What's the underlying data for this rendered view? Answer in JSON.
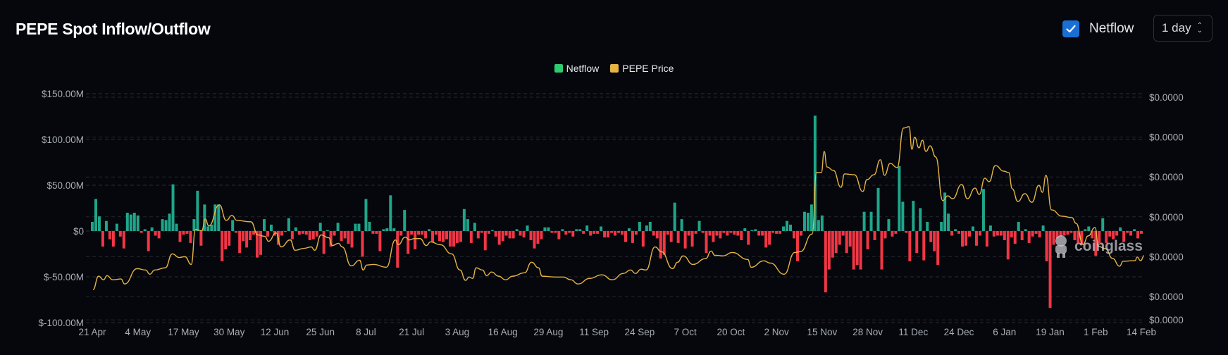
{
  "header": {
    "title": "PEPE Spot Inflow/Outflow",
    "netflow_toggle": {
      "label": "Netflow",
      "checked": true
    },
    "interval_select": {
      "value": "1 day"
    }
  },
  "watermark": "coinglass",
  "colors": {
    "inflow": "#1fa68a",
    "outflow": "#f23645",
    "price": "#e5b443",
    "checkbox": "#1a6fd4"
  },
  "chart_data": {
    "type": "bar+line",
    "title": "PEPE Spot Inflow/Outflow",
    "legend": [
      {
        "label": "Netflow",
        "color": "#2ecc71"
      },
      {
        "label": "PEPE Price",
        "color": "#e5b443"
      }
    ],
    "legend_position": "top-center",
    "grid": true,
    "x_tick_labels": [
      "21 Apr",
      "4 May",
      "17 May",
      "30 May",
      "12 Jun",
      "25 Jun",
      "8 Jul",
      "21 Jul",
      "3 Aug",
      "16 Aug",
      "29 Aug",
      "11 Sep",
      "24 Sep",
      "7 Oct",
      "20 Oct",
      "2 Nov",
      "15 Nov",
      "28 Nov",
      "11 Dec",
      "24 Dec",
      "6 Jan",
      "19 Jan",
      "1 Feb",
      "14 Feb"
    ],
    "x_tick_step_days": 13,
    "days": 300,
    "left_axis": {
      "unit": "USD millions",
      "ylim": [
        -100,
        150
      ],
      "ticks": [
        150,
        100,
        50,
        0,
        -50,
        -100
      ],
      "tick_labels": [
        "$150.00M",
        "$100.00M",
        "$50.00M",
        "$0",
        "$-50.00M",
        "$-100.00M"
      ]
    },
    "right_axis": {
      "unit": "USD (x1e-6, approx)",
      "ylim": [
        4.83,
        16.2
      ],
      "ticks": [
        16,
        14,
        12,
        10,
        8,
        6,
        4.83
      ],
      "tick_labels": [
        "$0.0000",
        "$0.0000",
        "$0.0000",
        "$0.0000",
        "$0.0000",
        "$0.0000",
        "$0.0000"
      ]
    },
    "netflow_musd": [
      10,
      35,
      16,
      -17,
      11,
      -9,
      -17,
      8,
      -6,
      -19,
      20,
      18,
      20,
      17,
      -2,
      2,
      -22,
      4,
      -5,
      -8,
      13,
      12,
      19,
      51,
      8,
      -12,
      -4,
      -3,
      -13,
      13,
      44,
      -16,
      29,
      5,
      7,
      29,
      29,
      -33,
      -20,
      -16,
      12,
      -2,
      -24,
      -11,
      -18,
      -10,
      -4,
      -29,
      -26,
      13,
      -6,
      7,
      -5,
      -15,
      -5,
      -1,
      14,
      -9,
      4,
      -4,
      -3,
      -4,
      -10,
      -9,
      -6,
      9,
      -25,
      1,
      -17,
      -5,
      9,
      -11,
      -8,
      -14,
      -18,
      8,
      8,
      -28,
      35,
      10,
      -3,
      -3,
      -22,
      2,
      3,
      39,
      3,
      -40,
      -5,
      23,
      -25,
      -4,
      -20,
      -4,
      -4,
      -8,
      2,
      -12,
      -4,
      -11,
      -12,
      -9,
      -17,
      -17,
      -13,
      -12,
      24,
      13,
      -13,
      9,
      -8,
      -2,
      -21,
      -3,
      1,
      -6,
      -15,
      -11,
      -5,
      -8,
      -8,
      2,
      -5,
      -7,
      6,
      -10,
      -19,
      -14,
      -9,
      4,
      4,
      -2,
      -2,
      -9,
      2,
      -4,
      -2,
      -6,
      2,
      2,
      -3,
      6,
      -5,
      -3,
      -3,
      5,
      -7,
      -7,
      -2,
      -5,
      -2,
      -4,
      -12,
      3,
      -13,
      -4,
      10,
      -17,
      6,
      10,
      -5,
      -8,
      -30,
      -26,
      -4,
      -12,
      31,
      -13,
      13,
      -19,
      -5,
      -17,
      -3,
      11,
      -2,
      -24,
      -5,
      -12,
      -5,
      -8,
      -2,
      -5,
      -2,
      -4,
      -5,
      -10,
      3,
      -15,
      1,
      2,
      -5,
      -5,
      -18,
      -15,
      -2,
      -3,
      -3,
      5,
      11,
      7,
      -8,
      -33,
      -5,
      21,
      20,
      29,
      126,
      12,
      17,
      -67,
      -42,
      -29,
      -24,
      -15,
      -5,
      -24,
      -17,
      -42,
      -37,
      -42,
      21,
      -20,
      21,
      -10,
      47,
      -42,
      -8,
      13,
      -6,
      -3,
      71,
      32,
      -2,
      -33,
      33,
      -24,
      25,
      -32,
      10,
      -12,
      -22,
      -37,
      10,
      42,
      19,
      -5,
      2,
      -3,
      -17,
      -16,
      -6,
      5,
      -16,
      -5,
      46,
      -17,
      6,
      -6,
      -5,
      -5,
      -10,
      -31,
      -7,
      -14,
      10,
      -10,
      2,
      -13,
      -6,
      -3,
      -7,
      6,
      -33,
      -84,
      -15,
      -8,
      -6,
      -5,
      -4,
      -2,
      -10,
      -13,
      -15,
      2,
      5,
      -8,
      -27,
      -13,
      14,
      -13,
      -6,
      -9,
      -5,
      4,
      -12,
      -2,
      -5,
      2,
      -8,
      -3
    ],
    "price_series": [
      [
        0.2,
        6.35
      ],
      [
        1.8,
        7.02
      ],
      [
        3.2,
        6.84
      ],
      [
        4.2,
        7.05
      ],
      [
        5.8,
        6.84
      ],
      [
        8.2,
        6.88
      ],
      [
        9.2,
        6.63
      ],
      [
        12.8,
        7.4
      ],
      [
        15.2,
        7.33
      ],
      [
        16.4,
        7.12
      ],
      [
        17.8,
        7.33
      ],
      [
        20.8,
        7.44
      ],
      [
        22.8,
        8.14
      ],
      [
        24.8,
        7.96
      ],
      [
        26.4,
        8.0
      ],
      [
        28.2,
        7.61
      ],
      [
        29.4,
        9.37
      ],
      [
        31.2,
        9.3
      ],
      [
        32.2,
        9.89
      ],
      [
        33.2,
        9.54
      ],
      [
        36.2,
        10.6
      ],
      [
        38.2,
        9.82
      ],
      [
        39.8,
        10.07
      ],
      [
        41.2,
        9.82
      ],
      [
        45.2,
        9.75
      ],
      [
        47.2,
        9.09
      ],
      [
        49.2,
        9.02
      ],
      [
        50.2,
        8.77
      ],
      [
        52.4,
        9.19
      ],
      [
        53.8,
        8.49
      ],
      [
        56.4,
        8.84
      ],
      [
        57.8,
        8.32
      ],
      [
        60.4,
        8.42
      ],
      [
        62.4,
        8.49
      ],
      [
        63.4,
        8.32
      ],
      [
        65.2,
        9.09
      ],
      [
        67.4,
        8.95
      ],
      [
        68.4,
        8.56
      ],
      [
        70.2,
        8.67
      ],
      [
        71.2,
        8.49
      ],
      [
        73.8,
        7.54
      ],
      [
        76.2,
        7.82
      ],
      [
        77.2,
        7.33
      ],
      [
        78.2,
        7.58
      ],
      [
        80.2,
        7.61
      ],
      [
        83.8,
        7.47
      ],
      [
        86.4,
        8.84
      ],
      [
        87.2,
        8.6
      ],
      [
        89.2,
        8.98
      ],
      [
        90.4,
        8.84
      ],
      [
        91.8,
        8.91
      ],
      [
        93.4,
        8.91
      ],
      [
        95.2,
        8.56
      ],
      [
        96.4,
        8.74
      ],
      [
        99.2,
        8.6
      ],
      [
        102.4,
        8.14
      ],
      [
        104.8,
        7.33
      ],
      [
        106.4,
        6.81
      ],
      [
        107.4,
        6.98
      ],
      [
        108.4,
        6.91
      ],
      [
        109.4,
        7.44
      ],
      [
        111.2,
        7.33
      ],
      [
        112.4,
        7.05
      ],
      [
        113.8,
        7.23
      ],
      [
        115.8,
        7.02
      ],
      [
        117.8,
        6.84
      ],
      [
        119.8,
        7.02
      ],
      [
        123.2,
        7.19
      ],
      [
        125.2,
        7.72
      ],
      [
        127.2,
        7.44
      ],
      [
        128.2,
        7.02
      ],
      [
        131.8,
        6.98
      ],
      [
        134.2,
        6.98
      ],
      [
        136.4,
        6.84
      ],
      [
        138.4,
        6.63
      ],
      [
        141.8,
        6.91
      ],
      [
        145.2,
        7.09
      ],
      [
        148.2,
        6.84
      ],
      [
        151.4,
        7.16
      ],
      [
        153.4,
        7.33
      ],
      [
        154.8,
        7.16
      ],
      [
        156.4,
        7.37
      ],
      [
        157.8,
        7.33
      ],
      [
        160.4,
        8.49
      ],
      [
        162.2,
        8.25
      ],
      [
        165.4,
        7.4
      ],
      [
        166.8,
        7.72
      ],
      [
        168.4,
        8.04
      ],
      [
        171.2,
        7.61
      ],
      [
        174.8,
        7.9
      ],
      [
        176.4,
        8.28
      ],
      [
        177.4,
        8.07
      ],
      [
        179.8,
        8.04
      ],
      [
        182.4,
        8.21
      ],
      [
        186.8,
        7.86
      ],
      [
        187.8,
        7.47
      ],
      [
        191.4,
        7.79
      ],
      [
        193.2,
        7.68
      ],
      [
        197.2,
        7.12
      ],
      [
        200.2,
        8.21
      ],
      [
        201.8,
        8.25
      ],
      [
        205.2,
        9.14
      ],
      [
        206.4,
        12.22
      ],
      [
        207.8,
        12.22
      ],
      [
        208.6,
        13.28
      ],
      [
        209.4,
        12.5
      ],
      [
        211.2,
        12.33
      ],
      [
        213.4,
        11.48
      ],
      [
        214.4,
        12.15
      ],
      [
        217.2,
        12.11
      ],
      [
        219.6,
        11.27
      ],
      [
        220.8,
        11.87
      ],
      [
        222.8,
        12.11
      ],
      [
        224.6,
        12.86
      ],
      [
        225.8,
        12.08
      ],
      [
        227.4,
        12.68
      ],
      [
        229.4,
        12.47
      ],
      [
        231.2,
        14.45
      ],
      [
        232.8,
        14.52
      ],
      [
        233.6,
        13.39
      ],
      [
        234.4,
        13.99
      ],
      [
        235.6,
        13.46
      ],
      [
        236.6,
        13.84
      ],
      [
        237.6,
        13.28
      ],
      [
        238.8,
        13.56
      ],
      [
        240.4,
        13.0
      ],
      [
        242.4,
        10.81
      ],
      [
        243.8,
        11.05
      ],
      [
        245.2,
        10.91
      ],
      [
        247.8,
        11.62
      ],
      [
        249.4,
        10.91
      ],
      [
        251.6,
        11.44
      ],
      [
        252.8,
        11.12
      ],
      [
        254.4,
        11.94
      ],
      [
        255.6,
        11.76
      ],
      [
        257.4,
        12.57
      ],
      [
        259.8,
        12.29
      ],
      [
        261.2,
        12.22
      ],
      [
        262.2,
        11.41
      ],
      [
        263.8,
        10.77
      ],
      [
        265.8,
        11.16
      ],
      [
        267.8,
        10.73
      ],
      [
        269.8,
        11.58
      ],
      [
        270.8,
        11.23
      ],
      [
        271.8,
        12.08
      ],
      [
        273.4,
        10.35
      ],
      [
        276.4,
        10.03
      ],
      [
        279.2,
        9.96
      ],
      [
        280.4,
        9.67
      ],
      [
        282.4,
        8.61
      ],
      [
        283.8,
        9.04
      ],
      [
        285.8,
        9.46
      ],
      [
        286.8,
        8.51
      ],
      [
        288.8,
        8.4
      ],
      [
        290.8,
        7.91
      ],
      [
        292.8,
        7.52
      ],
      [
        293.8,
        7.77
      ],
      [
        297.2,
        7.8
      ],
      [
        297.8,
        7.98
      ],
      [
        298.8,
        7.8
      ],
      [
        299.8,
        8.05
      ]
    ]
  }
}
